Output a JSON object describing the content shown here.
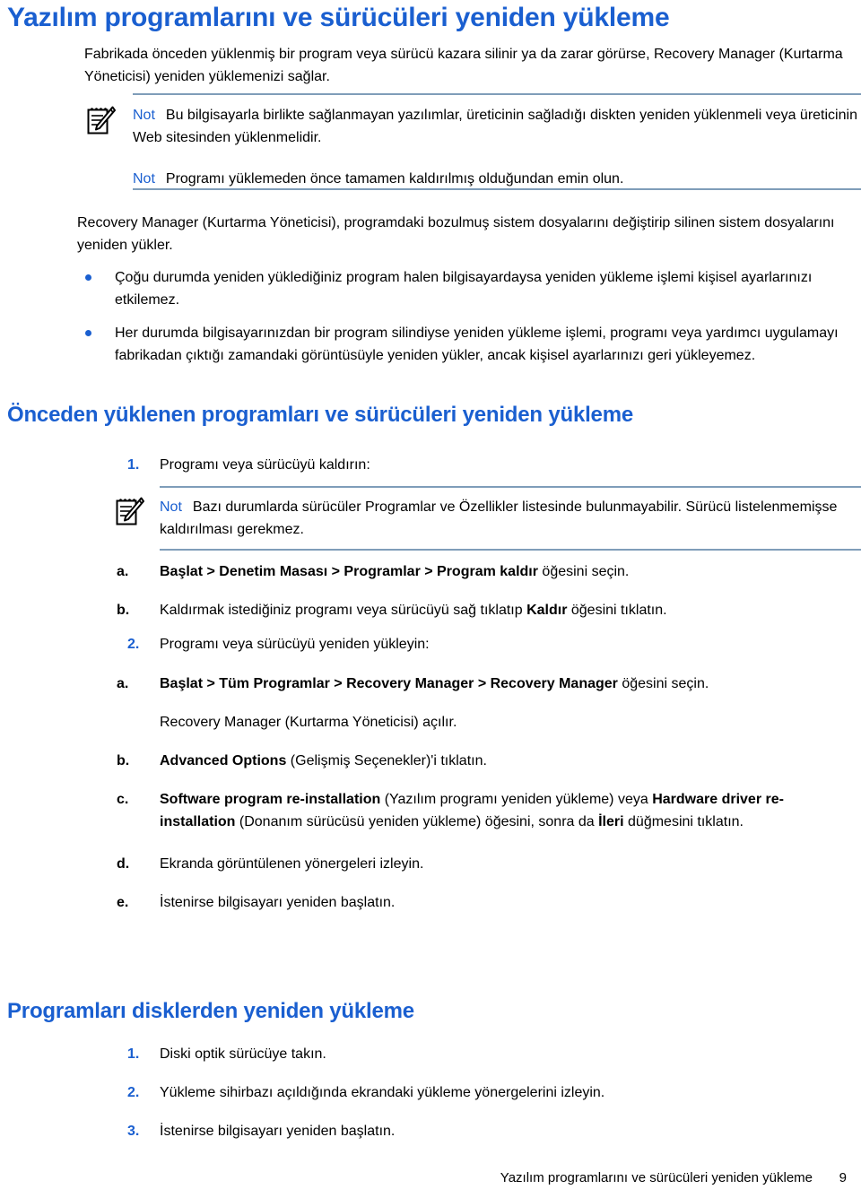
{
  "document": {
    "heading": "Yazılım programlarını ve sürücüleri yeniden yükleme",
    "intro_paragraph": "Fabrikada önceden yüklenmiş bir program veya sürücü kazara silinir ya da zarar görürse, Recovery Manager (Kurtarma Yöneticisi) yeniden yüklemenizi sağlar."
  },
  "colors": {
    "heading_blue": "#1a5fd0",
    "note_rule": "#7f9db9",
    "body_text": "#000000"
  },
  "note_box_1": {
    "icon": "notepad-pencil-icon",
    "lines": [
      {
        "label": "Not",
        "text": "Bu bilgisayarla birlikte sağlanmayan yazılımlar, üreticinin sağladığı diskten yeniden yüklenmeli veya üreticinin Web sitesinden yüklenmelidir."
      },
      {
        "label": "Not",
        "text": "Programı yüklemeden önce tamamen kaldırılmış olduğundan emin olun."
      }
    ]
  },
  "recovery_paragraph": "Recovery Manager (Kurtarma Yöneticisi), programdaki bozulmuş sistem dosyalarını değiştirip silinen sistem dosyalarını yeniden yükler.",
  "bullets": [
    "Çoğu durumda yeniden yüklediğiniz program halen bilgisayardaysa yeniden yükleme işlemi kişisel ayarlarınızı etkilemez.",
    "Her durumda bilgisayarınızdan bir program silindiyse yeniden yükleme işlemi, programı veya yardımcı uygulamayı fabrikadan çıktığı zamandaki görüntüsüyle yeniden yükler, ancak kişisel ayarlarınızı geri yükleyemez."
  ],
  "section_preinstalled": {
    "heading": "Önceden yüklenen programları ve sürücüleri yeniden yükleme",
    "step1": {
      "marker": "1.",
      "text": "Programı veya sürücüyü kaldırın:"
    },
    "note_box_2": {
      "icon": "notepad-pencil-icon",
      "label": "Not",
      "text": "Bazı durumlarda sürücüler Programlar ve Özellikler listesinde bulunmayabilir. Sürücü listelenmemişse kaldırılması gerekmez."
    },
    "step1_items": [
      {
        "marker": "a.",
        "bold_1": "Başlat > Denetim Masası > Programlar > Program kaldır",
        "rest": " öğesini seçin."
      },
      {
        "marker": "b.",
        "lead": "Kaldırmak istediğiniz programı veya sürücüyü sağ tıklatıp ",
        "bold_1": "Kaldır",
        "rest": " öğesini tıklatın."
      }
    ],
    "step2": {
      "marker": "2.",
      "text": "Programı veya sürücüyü yeniden yükleyin:"
    },
    "step2_items": [
      {
        "marker": "a.",
        "bold_1": "Başlat > Tüm Programlar > Recovery Manager > Recovery Manager",
        "rest": " öğesini seçin.",
        "follow_paragraph": "Recovery Manager (Kurtarma Yöneticisi) açılır."
      },
      {
        "marker": "b.",
        "bold_1": "Advanced Options",
        "rest": " (Gelişmiş Seçenekler)'i tıklatın."
      },
      {
        "marker": "c.",
        "bold_1": "Software program re-installation",
        "mid_1": " (Yazılım programı yeniden yükleme) veya ",
        "bold_2": "Hardware driver re-installation",
        "mid_2": " (Donanım sürücüsü yeniden yükleme) öğesini, sonra da ",
        "bold_3": "İleri",
        "rest": " düğmesini tıklatın."
      },
      {
        "marker": "d.",
        "text": "Ekranda görüntülenen yönergeleri izleyin."
      },
      {
        "marker": "e.",
        "text": "İstenirse bilgisayarı yeniden başlatın."
      }
    ]
  },
  "section_discs": {
    "heading": "Programları disklerden yeniden yükleme",
    "steps": [
      {
        "marker": "1.",
        "text": "Diski optik sürücüye takın."
      },
      {
        "marker": "2.",
        "text": "Yükleme sihirbazı açıldığında ekrandaki yükleme yönergelerini izleyin."
      },
      {
        "marker": "3.",
        "text": "İstenirse bilgisayarı yeniden başlatın."
      }
    ]
  },
  "footer": {
    "title": "Yazılım programlarını ve sürücüleri yeniden yükleme",
    "page_number": "9"
  }
}
